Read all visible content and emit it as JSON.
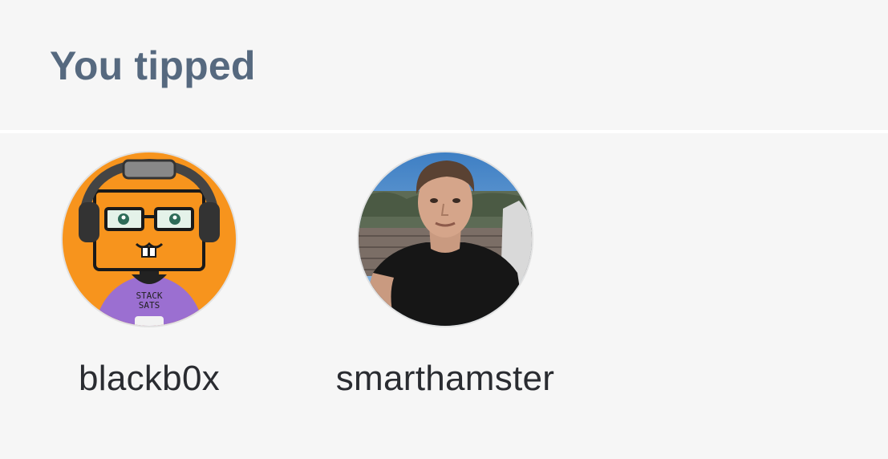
{
  "section": {
    "title": "You tipped"
  },
  "tipped_users": [
    {
      "username": "blackb0x",
      "avatar_icon": "robot-avatar-icon",
      "avatar_shirt_text_1": "STACK",
      "avatar_shirt_text_2": "SATS"
    },
    {
      "username": "smarthamster",
      "avatar_icon": "photo-avatar-icon"
    }
  ],
  "colors": {
    "background": "#f6f6f6",
    "title": "#56697f",
    "username": "#2a2c31",
    "avatar_orange": "#f7941d",
    "hoodie_purple": "#9b6fd1"
  }
}
